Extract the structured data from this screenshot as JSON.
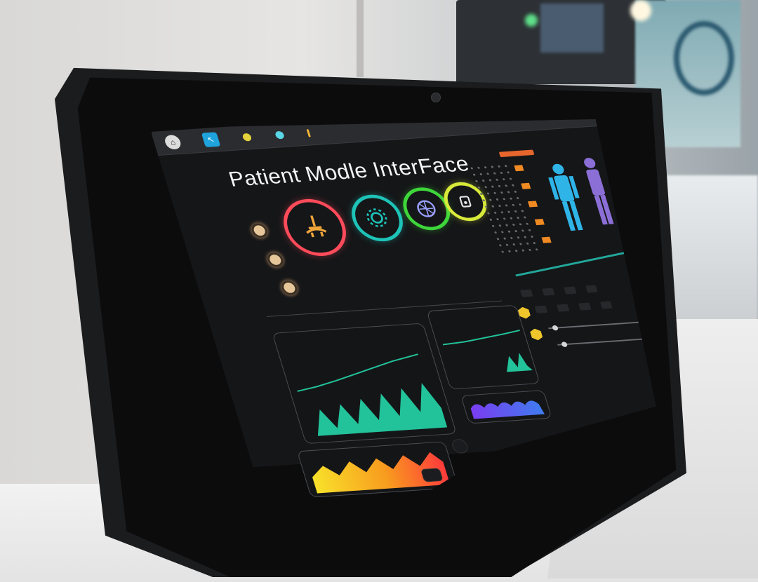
{
  "app": {
    "title": "Patient Modle  InterFace"
  },
  "topbar": {
    "icons": [
      "home-icon",
      "pointer-icon",
      "status-yellow-icon",
      "status-cyan-icon",
      "alert-bar-icon"
    ],
    "window_controls": [
      "minimize-icon",
      "restore-icon",
      "close-icon"
    ]
  },
  "vitals_rings": [
    {
      "name": "cardiac",
      "color": "#ff4b5a",
      "icon": "stethoscope-icon"
    },
    {
      "name": "settings",
      "color": "#1ec3b8",
      "icon": "gear-icon"
    },
    {
      "name": "network",
      "color": "#3ed63a",
      "icon": "network-icon"
    },
    {
      "name": "device",
      "color": "#d8ea3a",
      "icon": "device-icon"
    }
  ],
  "side_indicators": [
    {
      "color": "#e7c79a"
    },
    {
      "color": "#e7c79a"
    },
    {
      "color": "#e7c79a"
    }
  ],
  "charts": {
    "waveform_main": {
      "color": "#22c29a",
      "peaks": 6
    },
    "waveform_small": {
      "color": "#22c29a",
      "peaks": 3
    },
    "heat_strip": {
      "colors": [
        "#f8e12a",
        "#f89b1e",
        "#ff3b3b"
      ]
    },
    "purple_strip": {
      "colors": [
        "#7a3df0",
        "#3f7cf0"
      ]
    }
  },
  "right_panel": {
    "figures": [
      {
        "name": "figure-front",
        "color": "#2fb4e8"
      },
      {
        "name": "figure-side",
        "color": "#8b6fd6"
      }
    ],
    "accent": "#e7662d",
    "line_color": "#22a79b",
    "hex_buttons_color": "#f0c52c"
  }
}
